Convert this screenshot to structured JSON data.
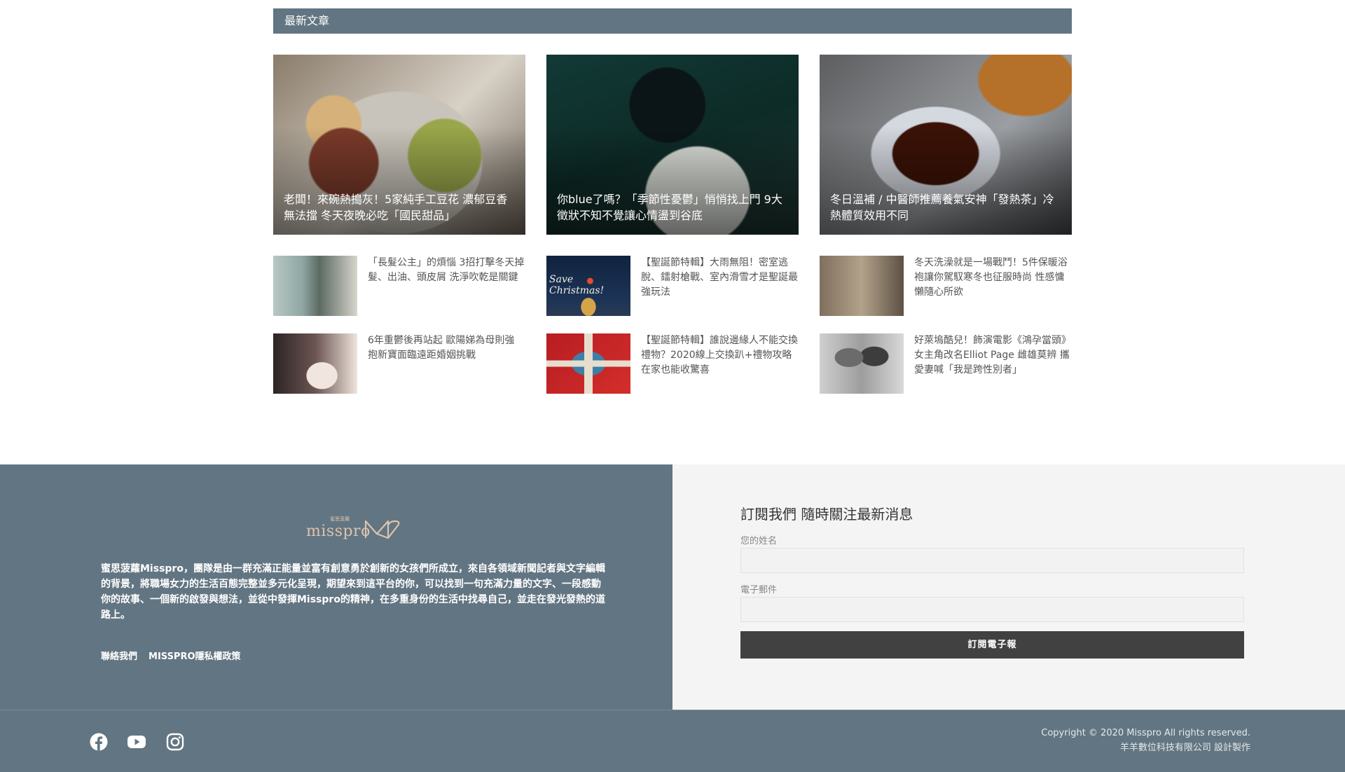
{
  "section": {
    "title": "最新文章"
  },
  "featured": [
    {
      "title": "老闆！來碗熱搗灰！5家純手工豆花 濃郁豆香無法擋 冬天夜晚必吃「國民甜品」"
    },
    {
      "title": "你blue了嗎？「季節性憂鬱」悄悄找上門 9大徵狀不知不覺讓心情盪到谷底"
    },
    {
      "title": "冬日溫補 / 中醫師推薦養氣安神「發熱茶」冷熱體質效用不同"
    }
  ],
  "articles": [
    {
      "title": "「長髮公主」的煩惱 3招打擊冬天掉髮、出油、頭皮屑 洗淨吹乾是關鍵"
    },
    {
      "title": "【聖誕節特輯】大雨無阻！密室逃脫、鐳射槍戰、室內滑雪才是聖誕最強玩法"
    },
    {
      "title": "冬天洗澡就是一場戰鬥！5件保暖浴袍讓你駕馭寒冬也征服時尚 性感慵懶隨心所欲"
    },
    {
      "title": "6年重鬱後再站起 歐陽娣為母則強 抱新寶面臨遠距婚姻挑戰"
    },
    {
      "title": "【聖誕節特輯】誰說邊緣人不能交換禮物？2020線上交換趴+禮物攻略 在家也能收驚喜"
    },
    {
      "title": "好萊塢酷兒！飾演電影《鴻孕當頭》女主角改名Elliot Page 雌雄莫辨 攜愛妻喊「我是跨性別者」"
    }
  ],
  "xmas_overlay": "Save Christmas!",
  "footer": {
    "logo_text": "misspro",
    "logo_sub": "蜜思菠蘿",
    "about": "蜜思菠蘿Misspro，團隊是由一群充滿正能量並富有創意勇於創新的女孩們所成立，來自各領域新聞記者與文字編輯的背景，將職場女力的生活百態完整並多元化呈現，期望來到這平台的你，可以找到一句充滿力量的文字、一段感動你的故事、一個新的啟發與想法，並從中發揮Misspro的精神，在多重身份的生活中找尋自己，並走在發光發熱的道路上。",
    "links": [
      "聯絡我們",
      "MISSPRO隱私權政策"
    ]
  },
  "subscribe": {
    "heading": "訂閱我們 隨時關注最新消息",
    "name_label": "您的姓名",
    "email_label": "電子郵件",
    "button": "訂閱電子報"
  },
  "social": [
    "facebook-icon",
    "youtube-icon",
    "instagram-icon"
  ],
  "copyright": {
    "line1": "Copyright © 2020 Misspro All rights reserved.",
    "line2": "羊羊數位科技有限公司 設計製作"
  },
  "colors": {
    "slate": "#627582",
    "button": "#414141",
    "logo": "#dcc3ae"
  }
}
